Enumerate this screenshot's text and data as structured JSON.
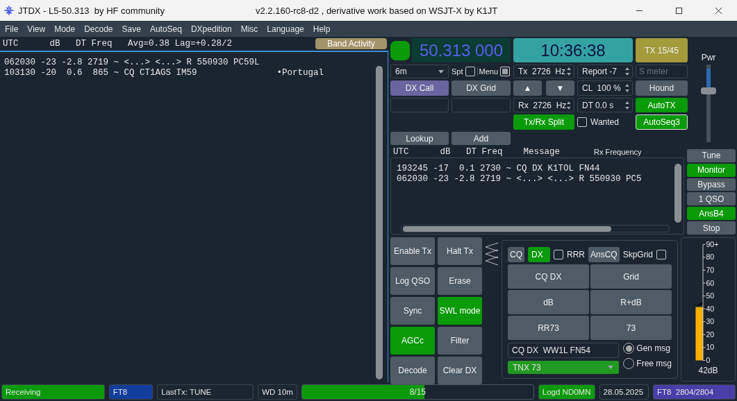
{
  "window": {
    "title": "JTDX - L5-50.313  by HF community",
    "subtitle": "v2.2.160-rc8-d2 , derivative work based on WSJT-X by K1JT"
  },
  "menu": [
    "File",
    "View",
    "Mode",
    "Decode",
    "Save",
    "AutoSeq",
    "DXpedition",
    "Misc",
    "Language",
    "Help"
  ],
  "band_activity": {
    "header": "UTC      dB   DT Freq   Avg=0.38 Lag=+0.28/2",
    "button": "Band Activity",
    "lines": [
      {
        "text": "062030 -23 -2.8 2719 ~ <...> <...> R 550930 PC59L"
      },
      {
        "text": "103130 -20  0.6  865 ~ CQ CT1AGS IM59",
        "country": "•Portugal"
      }
    ]
  },
  "controls": {
    "indicator_on": true,
    "frequency": "50.313 000",
    "clock": "10:36:38",
    "tx_period": "TX 15/45",
    "band": "6m",
    "spot": {
      "label": "Spt",
      "checked": false
    },
    "menu_toggle": {
      "label": "Menu",
      "checked": true
    },
    "dx_call": {
      "label": "DX Call",
      "highlighted": true
    },
    "dx_grid": {
      "label": "DX Grid",
      "highlighted": false
    },
    "lookup": "Lookup",
    "add": "Add",
    "tx_freq": "Tx  2726  Hz",
    "rx_freq": "Rx  2726  Hz",
    "up": "▲",
    "down": "▼",
    "split": {
      "label": "Tx/Rx Split",
      "on": true
    },
    "report": "Report -7",
    "cl": "CL  100 %",
    "dt": "DT 0.0 s",
    "wanted": {
      "label": "Wanted",
      "checked": false
    },
    "s_meter": {
      "placeholder": "S meter"
    },
    "hound": {
      "label": "Hound",
      "on": false
    },
    "autotx": {
      "label": "AutoTX",
      "on": true
    },
    "autoseq": {
      "label": "AutoSeq3",
      "on": true
    },
    "power": {
      "label": "Pwr",
      "level": 0.66
    }
  },
  "rx_panel": {
    "header": "UTC      dB   DT Freq    Message",
    "title": "Rx Frequency",
    "lines": [
      {
        "text": "193245 -17  0.1 2730 ~ CQ DX K1TOL FN44"
      },
      {
        "text": "062030 -23 -2.8 2719 ~ <...> <...> R 550930 PC5"
      }
    ]
  },
  "side_buttons": [
    {
      "label": "Tune",
      "on": false
    },
    {
      "label": "Monitor",
      "on": true
    },
    {
      "label": "Bypass",
      "on": false
    },
    {
      "label": "1 QSO",
      "on": false
    },
    {
      "label": "AnsB4",
      "on": true
    },
    {
      "label": "Stop",
      "on": false
    }
  ],
  "action_buttons": [
    {
      "label": "Enable Tx",
      "on": false
    },
    {
      "label": "Halt Tx",
      "on": false
    },
    {
      "label": "Log QSO",
      "on": false
    },
    {
      "label": "Erase",
      "on": false
    },
    {
      "label": "Sync",
      "on": false
    },
    {
      "label": "SWL mode",
      "on": true
    },
    {
      "label": "AGCc",
      "on": true
    },
    {
      "label": "Filter",
      "on": false
    },
    {
      "label": "Decode",
      "on": false
    },
    {
      "label": "Clear DX",
      "on": false
    }
  ],
  "tx_panel": {
    "cq": {
      "label": "CQ",
      "on": false
    },
    "dx": {
      "label": "DX",
      "on": true
    },
    "rrr": {
      "label": "RRR",
      "checked": false
    },
    "ans_cq": {
      "label": "AnsCQ",
      "on": false
    },
    "skip_grid": {
      "label": "SkpGrid",
      "checked": false
    },
    "messages": [
      "CQ DX",
      "Grid",
      "dB",
      "R+dB",
      "RR73",
      "73"
    ],
    "message_field": "CQ DX  WW1L FN54",
    "free_message": "TNX 73",
    "modes": [
      {
        "label": "Gen msg",
        "selected": true
      },
      {
        "label": "Free msg",
        "selected": false
      }
    ]
  },
  "meter": {
    "ticks": [
      "90+",
      "80",
      "70",
      "60",
      "50",
      "40",
      "30",
      "20",
      "10",
      "0"
    ],
    "level": 0.46,
    "reading": "42dB"
  },
  "status_bar": [
    {
      "kind": "label",
      "text": "Receiving",
      "color": "#0a9a0a"
    },
    {
      "kind": "label",
      "text": "FT8",
      "color": "#123d9a"
    },
    {
      "kind": "label",
      "text": "LastTx: TUNE",
      "color": "#1c2630"
    },
    {
      "kind": "label",
      "text": "WD 10m",
      "color": "#1c2630"
    },
    {
      "kind": "progress",
      "text": "8/15",
      "level": 0.53
    },
    {
      "kind": "label",
      "text": "Logd ND0MN",
      "color": "#0a9a0a"
    },
    {
      "kind": "label",
      "text": "28.05.2025",
      "color": "#1c2630"
    },
    {
      "kind": "label",
      "text": "FT8  2804/2804",
      "color": "#4a3fa8"
    }
  ]
}
